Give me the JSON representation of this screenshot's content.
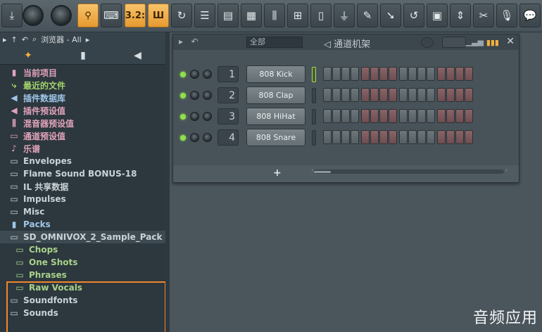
{
  "toolbar": {
    "icons": [
      "download-icon",
      "master-volume-knob",
      "master-pitch-knob",
      "metronome-icon",
      "typing-keyboard-icon",
      "countdown-icon",
      "step-edit-icon",
      "loop-record-icon",
      "playlist-icon",
      "piano-roll-icon",
      "channel-rack-icon",
      "mixer-icon",
      "plugin-picker-icon",
      "browser-icon",
      "plugin-database-icon",
      "touch-controller-icon",
      "render-icon",
      "undo-history-icon",
      "save-icon",
      "midi-settings-icon",
      "cpu-icon",
      "microphone-icon",
      "help-icon"
    ],
    "countdown_label": "3.2:",
    "accent": "#f0a63a"
  },
  "browser": {
    "title": "浏览器 - All",
    "items": [
      {
        "label": "当前项目",
        "type": "pink",
        "icon": "project-icon"
      },
      {
        "label": "最近的文件",
        "type": "green",
        "icon": "recent-folder-icon"
      },
      {
        "label": "插件数据库",
        "type": "blue",
        "icon": "plugin-db-icon"
      },
      {
        "label": "插件预设值",
        "type": "pink",
        "icon": "plugin-preset-icon"
      },
      {
        "label": "混音器预设值",
        "type": "pink",
        "icon": "mixer-preset-icon"
      },
      {
        "label": "通道预设值",
        "type": "pink",
        "icon": "channel-preset-icon"
      },
      {
        "label": "乐谱",
        "type": "pink",
        "icon": "score-icon"
      },
      {
        "label": "Envelopes",
        "type": "folder",
        "icon": "folder-icon"
      },
      {
        "label": "Flame Sound BONUS-18",
        "type": "folder",
        "icon": "folder-icon"
      },
      {
        "label": "IL 共享数据",
        "type": "folder",
        "icon": "folder-icon"
      },
      {
        "label": "Impulses",
        "type": "folder",
        "icon": "folder-icon"
      },
      {
        "label": "Misc",
        "type": "folder",
        "icon": "folder-icon"
      },
      {
        "label": "Packs",
        "type": "blue",
        "icon": "packs-icon"
      },
      {
        "label": "SD_OMNIVOX_2_Sample_Pack",
        "type": "folder",
        "icon": "open-folder-icon",
        "selected": true
      },
      {
        "label": "Chops",
        "type": "sub",
        "icon": "sub-folder-icon"
      },
      {
        "label": "One Shots",
        "type": "sub",
        "icon": "sub-folder-icon"
      },
      {
        "label": "Phrases",
        "type": "sub",
        "icon": "sub-folder-icon"
      },
      {
        "label": "Raw Vocals",
        "type": "sub",
        "icon": "sub-folder-icon"
      },
      {
        "label": "Soundfonts",
        "type": "folder",
        "icon": "folder-icon"
      },
      {
        "label": "Sounds",
        "type": "folder",
        "icon": "folder-icon"
      }
    ]
  },
  "rack": {
    "filter": "全部",
    "title": "通道机架",
    "channels": [
      {
        "num": "1",
        "name": "808 Kick",
        "active": true
      },
      {
        "num": "2",
        "name": "808 Clap",
        "active": false
      },
      {
        "num": "3",
        "name": "808 HiHat",
        "active": false
      },
      {
        "num": "4",
        "name": "808 Snare",
        "active": false
      }
    ],
    "step_pattern": [
      "g",
      "g",
      "g",
      "g",
      "r",
      "r",
      "r",
      "r",
      "g",
      "g",
      "g",
      "g",
      "r",
      "r",
      "r",
      "r"
    ],
    "add_label": "+"
  },
  "watermark": "音频应用"
}
